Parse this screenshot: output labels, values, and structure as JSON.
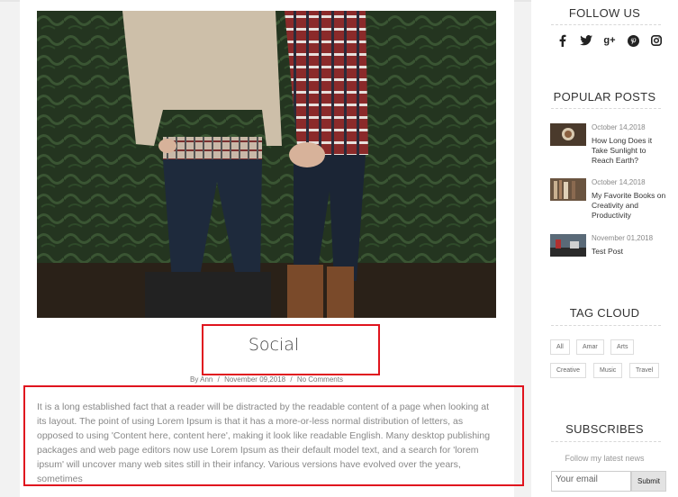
{
  "post": {
    "title": "Social",
    "meta": {
      "by_prefix": "By",
      "author": "Ann",
      "separator": "/",
      "date": "November 09,2018",
      "comments": "No Comments"
    },
    "excerpt": "It is a long established fact that a reader will be distracted by the readable content of a page when looking at its layout. The point of using Lorem Ipsum is that it has a more-or-less normal distribution of letters, as opposed to using 'Content here, content here', making it look like readable English. Many desktop publishing packages and web page editors now use Lorem Ipsum as their default model text, and a search for 'lorem ipsum' will uncover many web sites still in their infancy. Various versions have evolved over the years, sometimes"
  },
  "sidebar": {
    "follow_title": "FOLLOW US",
    "social_icons": [
      "facebook-icon",
      "twitter-icon",
      "google-plus-icon",
      "pinterest-icon",
      "instagram-icon"
    ],
    "popular_title": "POPULAR POSTS",
    "popular_posts": [
      {
        "date": "October 14,2018",
        "title": "How Long Does it Take Sunlight to Reach Earth?"
      },
      {
        "date": "October 14,2018",
        "title": "My Favorite Books on Creativity and Productivity"
      },
      {
        "date": "November 01,2018",
        "title": "Test Post"
      }
    ],
    "tag_title": "TAG CLOUD",
    "tags": [
      "All",
      "Amar",
      "Arts",
      "Creative",
      "Music",
      "Travel"
    ],
    "subscribe_title": "SUBSCRIBES",
    "subscribe_text": "Follow my latest news",
    "email_placeholder": "Your email",
    "submit_label": "Submit"
  },
  "colors": {
    "highlight": "#e0141e",
    "background": "#f2f2f2"
  }
}
